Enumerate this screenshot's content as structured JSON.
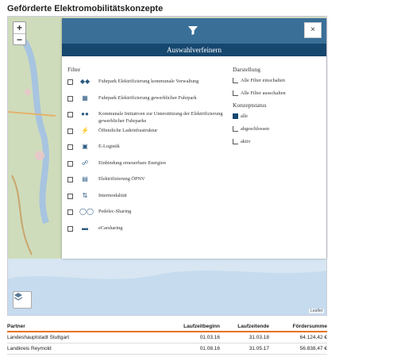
{
  "page": {
    "title": "Geförderte Elektromobilitätskonzepte"
  },
  "map": {
    "zoom_in": "+",
    "zoom_out": "−",
    "attribution": "Leaflet",
    "layer_icon": "layers-icon"
  },
  "filter_panel": {
    "header_icon": "filter-icon",
    "close_label": "×",
    "subtitle": "Auswahlverfeinern",
    "filter_section_label": "Filter",
    "items": [
      {
        "icon": "fleet-icon",
        "label": "Fuhrpark Elektrifizierung  kommunale Verwaltung"
      },
      {
        "icon": "building-icon",
        "label": "Fuhrpark Elektrifizierung  gewerblicher Fuhrpark"
      },
      {
        "icon": "people-icon",
        "label": "Kommunale Initiativen zur Unterstützung der Elektrifizierung gewerblicher Fuhrparke"
      },
      {
        "icon": "charging-icon",
        "label": "Öffentliche Ladeinfrastruktur"
      },
      {
        "icon": "truck-icon",
        "label": "E-Logistik"
      },
      {
        "icon": "plug-icon",
        "label": "Einbindung erneuerbare Energien"
      },
      {
        "icon": "bus-icon",
        "label": "Elektrifizierung ÖPNV"
      },
      {
        "icon": "intermodal-icon",
        "label": "Intermodalität"
      },
      {
        "icon": "bicycle-icon",
        "label": "Pedelec-Sharing"
      },
      {
        "icon": "car-icon",
        "label": "eCarsharing"
      }
    ],
    "display_section_label": "Darstellung",
    "display_options": [
      {
        "label": "Alle Filter einschalten"
      },
      {
        "label": "Alle Filter ausschalten"
      }
    ],
    "status_section_label": "Konzeptstatus",
    "status_options": [
      {
        "label": "alle",
        "selected": true
      },
      {
        "label": "abgeschlossen",
        "selected": false
      },
      {
        "label": "aktiv",
        "selected": false
      }
    ]
  },
  "table": {
    "headers": [
      "Partner",
      "Laufzeitbeginn",
      "Laufzeitende",
      "Fördersumme"
    ],
    "rows": [
      [
        "Landeshauptstadt Stuttgart",
        "01.03.16",
        "31.03.18",
        "64.124,42 €"
      ],
      [
        "Landkreis Reymold",
        "01.08.16",
        "31.05.17",
        "56.838,47 €"
      ]
    ]
  },
  "colors": {
    "accent": "#e8731e",
    "panel_header": "#3a6f98",
    "panel_subheader": "#16476f"
  }
}
